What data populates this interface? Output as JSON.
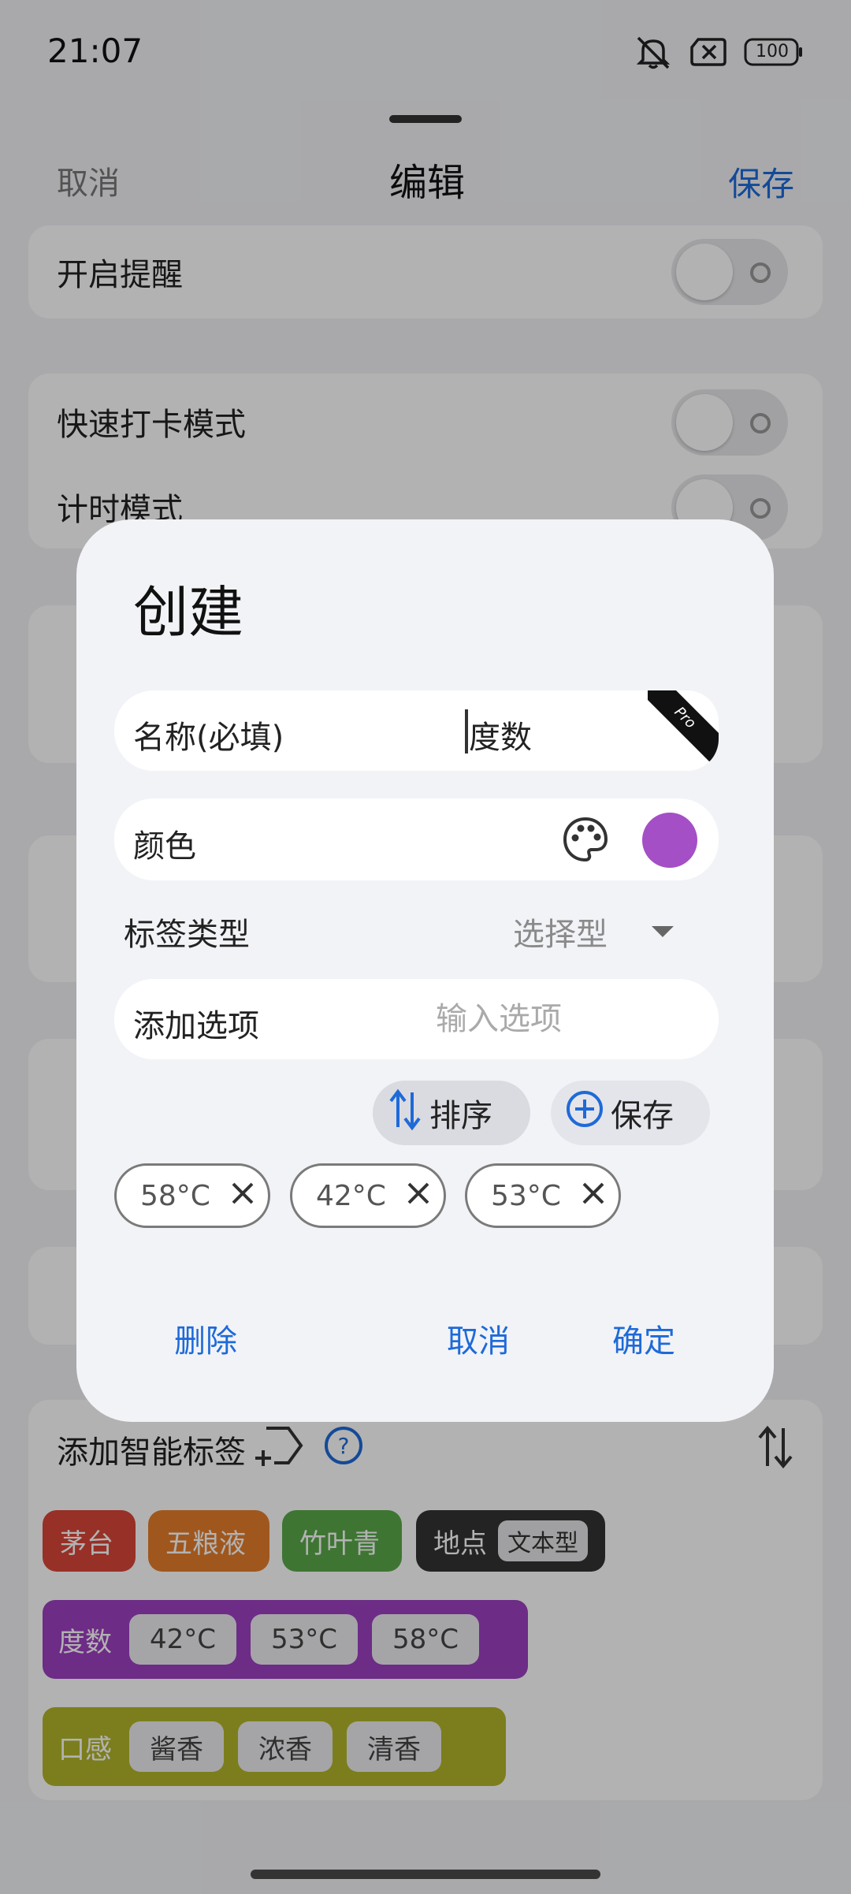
{
  "status_bar": {
    "time": "21:07",
    "battery": "100"
  },
  "nav": {
    "cancel": "取消",
    "title": "编辑",
    "save": "保存"
  },
  "settings": {
    "reminder": "开启提醒",
    "quick_mode": "快速打卡模式",
    "timer_mode": "计时模式"
  },
  "smart_tags": {
    "title": "添加智能标签",
    "chips": [
      {
        "label": "茅台",
        "color": "#d94538"
      },
      {
        "label": "五粮液",
        "color": "#e57d2a"
      },
      {
        "label": "竹叶青",
        "color": "#5aa84a"
      }
    ],
    "location": {
      "label": "地点",
      "type": "文本型",
      "color": "#333333"
    },
    "groups": [
      {
        "label": "度数",
        "color": "#9c3fc0",
        "options": [
          "42°C",
          "53°C",
          "58°C"
        ]
      },
      {
        "label": "口感",
        "color": "#b2b52a",
        "options": [
          "酱香",
          "浓香",
          "清香"
        ]
      }
    ]
  },
  "dialog": {
    "title": "创建",
    "name_label": "名称(必填)",
    "name_value": "度数",
    "pro_badge": "Pro",
    "color_label": "颜色",
    "color_value": "#a44fc5",
    "tag_type_label": "标签类型",
    "tag_type_value": "选择型",
    "add_option_label": "添加选项",
    "add_option_placeholder": "输入选项",
    "sort_button": "排序",
    "save_button": "保存",
    "options": [
      "58°C",
      "42°C",
      "53°C"
    ],
    "delete": "删除",
    "cancel": "取消",
    "confirm": "确定"
  }
}
